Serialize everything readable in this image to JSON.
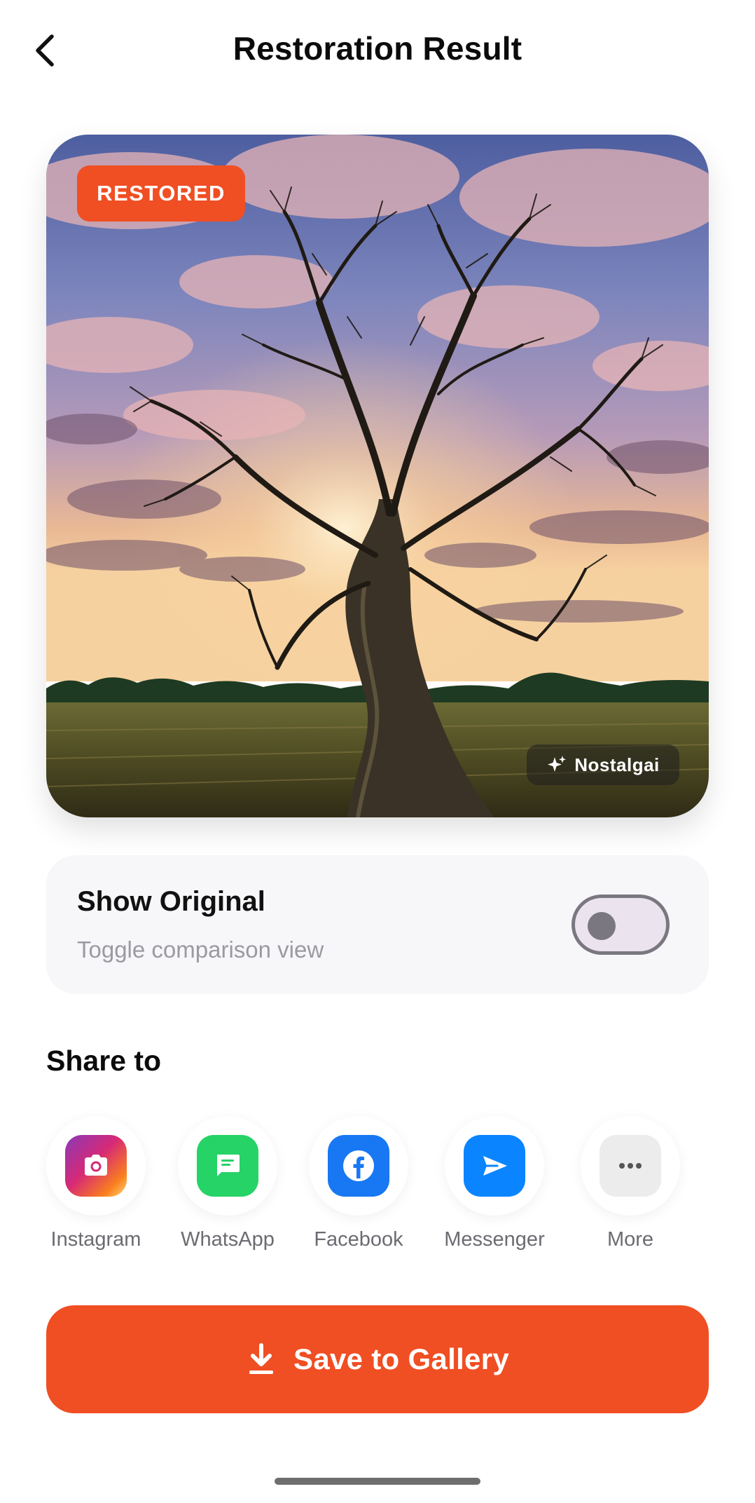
{
  "header": {
    "title": "Restoration Result",
    "back_icon": "chevron-left-icon"
  },
  "photo": {
    "badge": "RESTORED",
    "watermark": "Nostalgai",
    "watermark_icon": "sparkle-icon",
    "badge_color": "#f04e23"
  },
  "toggle": {
    "title": "Show Original",
    "subtitle": "Toggle comparison view",
    "on": false
  },
  "share": {
    "title": "Share to",
    "items": [
      {
        "label": "Instagram",
        "icon": "instagram-icon"
      },
      {
        "label": "WhatsApp",
        "icon": "whatsapp-icon"
      },
      {
        "label": "Facebook",
        "icon": "facebook-icon"
      },
      {
        "label": "Messenger",
        "icon": "messenger-icon"
      },
      {
        "label": "More",
        "icon": "more-icon"
      }
    ]
  },
  "save": {
    "label": "Save to Gallery",
    "icon": "download-icon"
  },
  "colors": {
    "accent": "#f04e23",
    "whatsapp": "#25d366",
    "facebook": "#1877f2",
    "messenger": "#0a84ff"
  }
}
